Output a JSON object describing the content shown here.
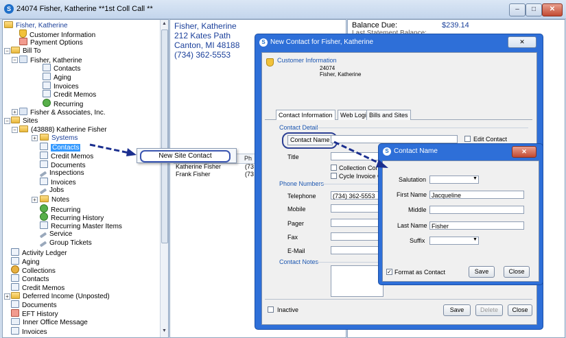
{
  "window": {
    "title": "24074  Fisher, Katherine    **1st Coll Call **",
    "app_icon": "S",
    "controls": {
      "minimize": "–",
      "maximize": "□",
      "close": "✕"
    }
  },
  "tree": {
    "root": "Fisher, Katherine",
    "items": [
      {
        "label": "Customer Information"
      },
      {
        "label": "Payment Options"
      },
      {
        "label": "Bill To"
      },
      {
        "label": "Fisher, Katherine"
      },
      {
        "label": "Contacts"
      },
      {
        "label": "Aging"
      },
      {
        "label": "Invoices"
      },
      {
        "label": "Credit Memos"
      },
      {
        "label": "Recurring"
      },
      {
        "label": "Fisher & Associates, Inc."
      },
      {
        "label": "Sites"
      },
      {
        "label": "(43888) Katherine Fisher"
      },
      {
        "label": "Systems"
      },
      {
        "label": "Contacts"
      },
      {
        "label": "Credit Memos"
      },
      {
        "label": "Documents"
      },
      {
        "label": "Inspections"
      },
      {
        "label": "Invoices"
      },
      {
        "label": "Jobs"
      },
      {
        "label": "Notes"
      },
      {
        "label": "Recurring"
      },
      {
        "label": "Recurring History"
      },
      {
        "label": "Recurring Master Items"
      },
      {
        "label": "Service"
      },
      {
        "label": "Group Tickets"
      },
      {
        "label": "Activity Ledger"
      },
      {
        "label": "Aging"
      },
      {
        "label": "Collections"
      },
      {
        "label": "Contacts"
      },
      {
        "label": "Credit Memos"
      },
      {
        "label": "Deferred Income (Unposted)"
      },
      {
        "label": "Documents"
      },
      {
        "label": "EFT History"
      },
      {
        "label": "Inner Office Message"
      },
      {
        "label": "Invoices"
      }
    ]
  },
  "customer": {
    "name": "Fisher, Katherine",
    "street": "212  Kates Path",
    "city": "Canton, MI  48188",
    "phone": "(734) 362-5553"
  },
  "contacts_list": {
    "header_phone": "Ph",
    "rows": [
      {
        "name": "Katherine Fisher",
        "phone": "(73"
      },
      {
        "name": "Frank Fisher",
        "phone": "(73"
      }
    ]
  },
  "balance": {
    "label": "Balance Due:",
    "value": "$239.14",
    "row2_label": "Last Statement Balance:",
    "row2_value": "$..."
  },
  "context_menu": {
    "item": "New Site Contact"
  },
  "new_contact_dialog": {
    "title": "New Contact for Fisher, Katherine",
    "close_glyph": "✕",
    "customer_info_label": "Customer Information",
    "customer_number": "24074",
    "customer_name": "Fisher, Katherine",
    "tabs": [
      "Contact Information",
      "Web Login",
      "Bills and Sites"
    ],
    "contact_detail_label": "Contact Detail",
    "contact_name_label": "Contact Name",
    "edit_contact_label": "Edit Contact",
    "title_label": "Title",
    "collection_contact_label": "Collection Contact",
    "cycle_invoice_label": "Cycle Invoice Contact",
    "phone_numbers_label": "Phone Numbers",
    "telephone_label": "Telephone",
    "telephone_value": "(734) 362-5553",
    "mobile_label": "Mobile",
    "pager_label": "Pager",
    "fax_label": "Fax",
    "email_label": "E-Mail",
    "contact_notes_label": "Contact Notes",
    "inactive_label": "Inactive",
    "save_label": "Save",
    "delete_label": "Delete",
    "close_label": "Close"
  },
  "contact_name_dialog": {
    "title": "Contact Name",
    "close_glyph": "✕",
    "salutation_label": "Salutation",
    "first_name_label": "First Name",
    "first_name_value": "Jacqueline",
    "middle_label": "Middle",
    "last_name_label": "Last Name",
    "last_name_value": "Fisher",
    "suffix_label": "Suffix",
    "format_as_contact_label": "Format as Contact",
    "save_label": "Save",
    "close_label": "Close"
  },
  "colors": {
    "accent": "#2e6fd8",
    "selection": "#3399ff",
    "link": "#1a3f9a",
    "annotation": "#1b2f8f"
  }
}
